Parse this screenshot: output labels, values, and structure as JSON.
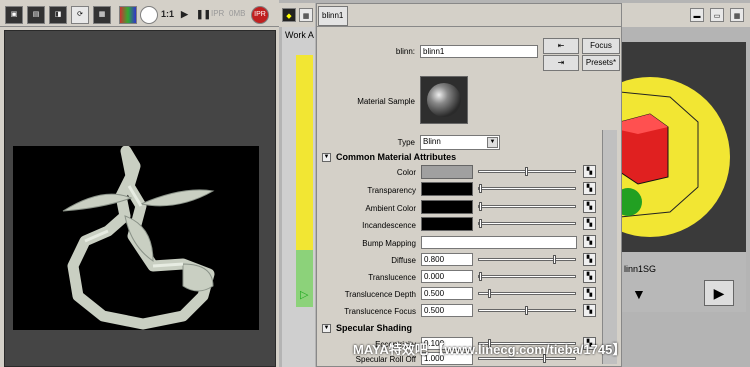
{
  "render_view": {
    "zoom_label": "1:1",
    "ipr_label": "IPR",
    "ipr_dim_label": "IPR",
    "mb_label": "0MB"
  },
  "workspace": {
    "work_area_label": "Work A"
  },
  "attribute_editor": {
    "tab_label": "blinn1",
    "node_type_label": "blinn:",
    "node_name": "blinn1",
    "focus_label": "Focus",
    "presets_label": "Presets*",
    "sample_label": "Material Sample",
    "type_label": "Type",
    "type_value": "Blinn",
    "common_section": "Common Material Attributes",
    "specular_section": "Specular Shading",
    "attributes": {
      "color": "Color",
      "transparency": "Transparency",
      "ambient": "Ambient Color",
      "incandescence": "Incandescence",
      "bump": "Bump Mapping",
      "diffuse": "Diffuse",
      "translucence": "Translucence",
      "trans_depth": "Translucence Depth",
      "trans_focus": "Translucence Focus",
      "eccentricity": "Eccentricity",
      "rolloff": "Specular Roll Off"
    },
    "values": {
      "diffuse": "0.800",
      "translucence": "0.000",
      "trans_depth": "0.500",
      "trans_focus": "0.500",
      "eccentricity": "0.100",
      "rolloff": "1.000"
    },
    "slider_levels": {
      "color": 0.5,
      "diffuse": 0.8,
      "translucence": 0.0,
      "trans_depth": 0.1,
      "trans_focus": 0.5,
      "eccentricity": 0.1,
      "rolloff": 0.7
    }
  },
  "hypershade": {
    "shading_group_label": "linn1SG"
  },
  "watermark": "MAYA特效吧 【www.linecg.com/tieba/1745】",
  "colors": {
    "color_swatch": "#a0a0a0",
    "black_swatch": "#000000",
    "yellow": "#f2e633",
    "red": "#e02020",
    "green": "#22a022"
  }
}
